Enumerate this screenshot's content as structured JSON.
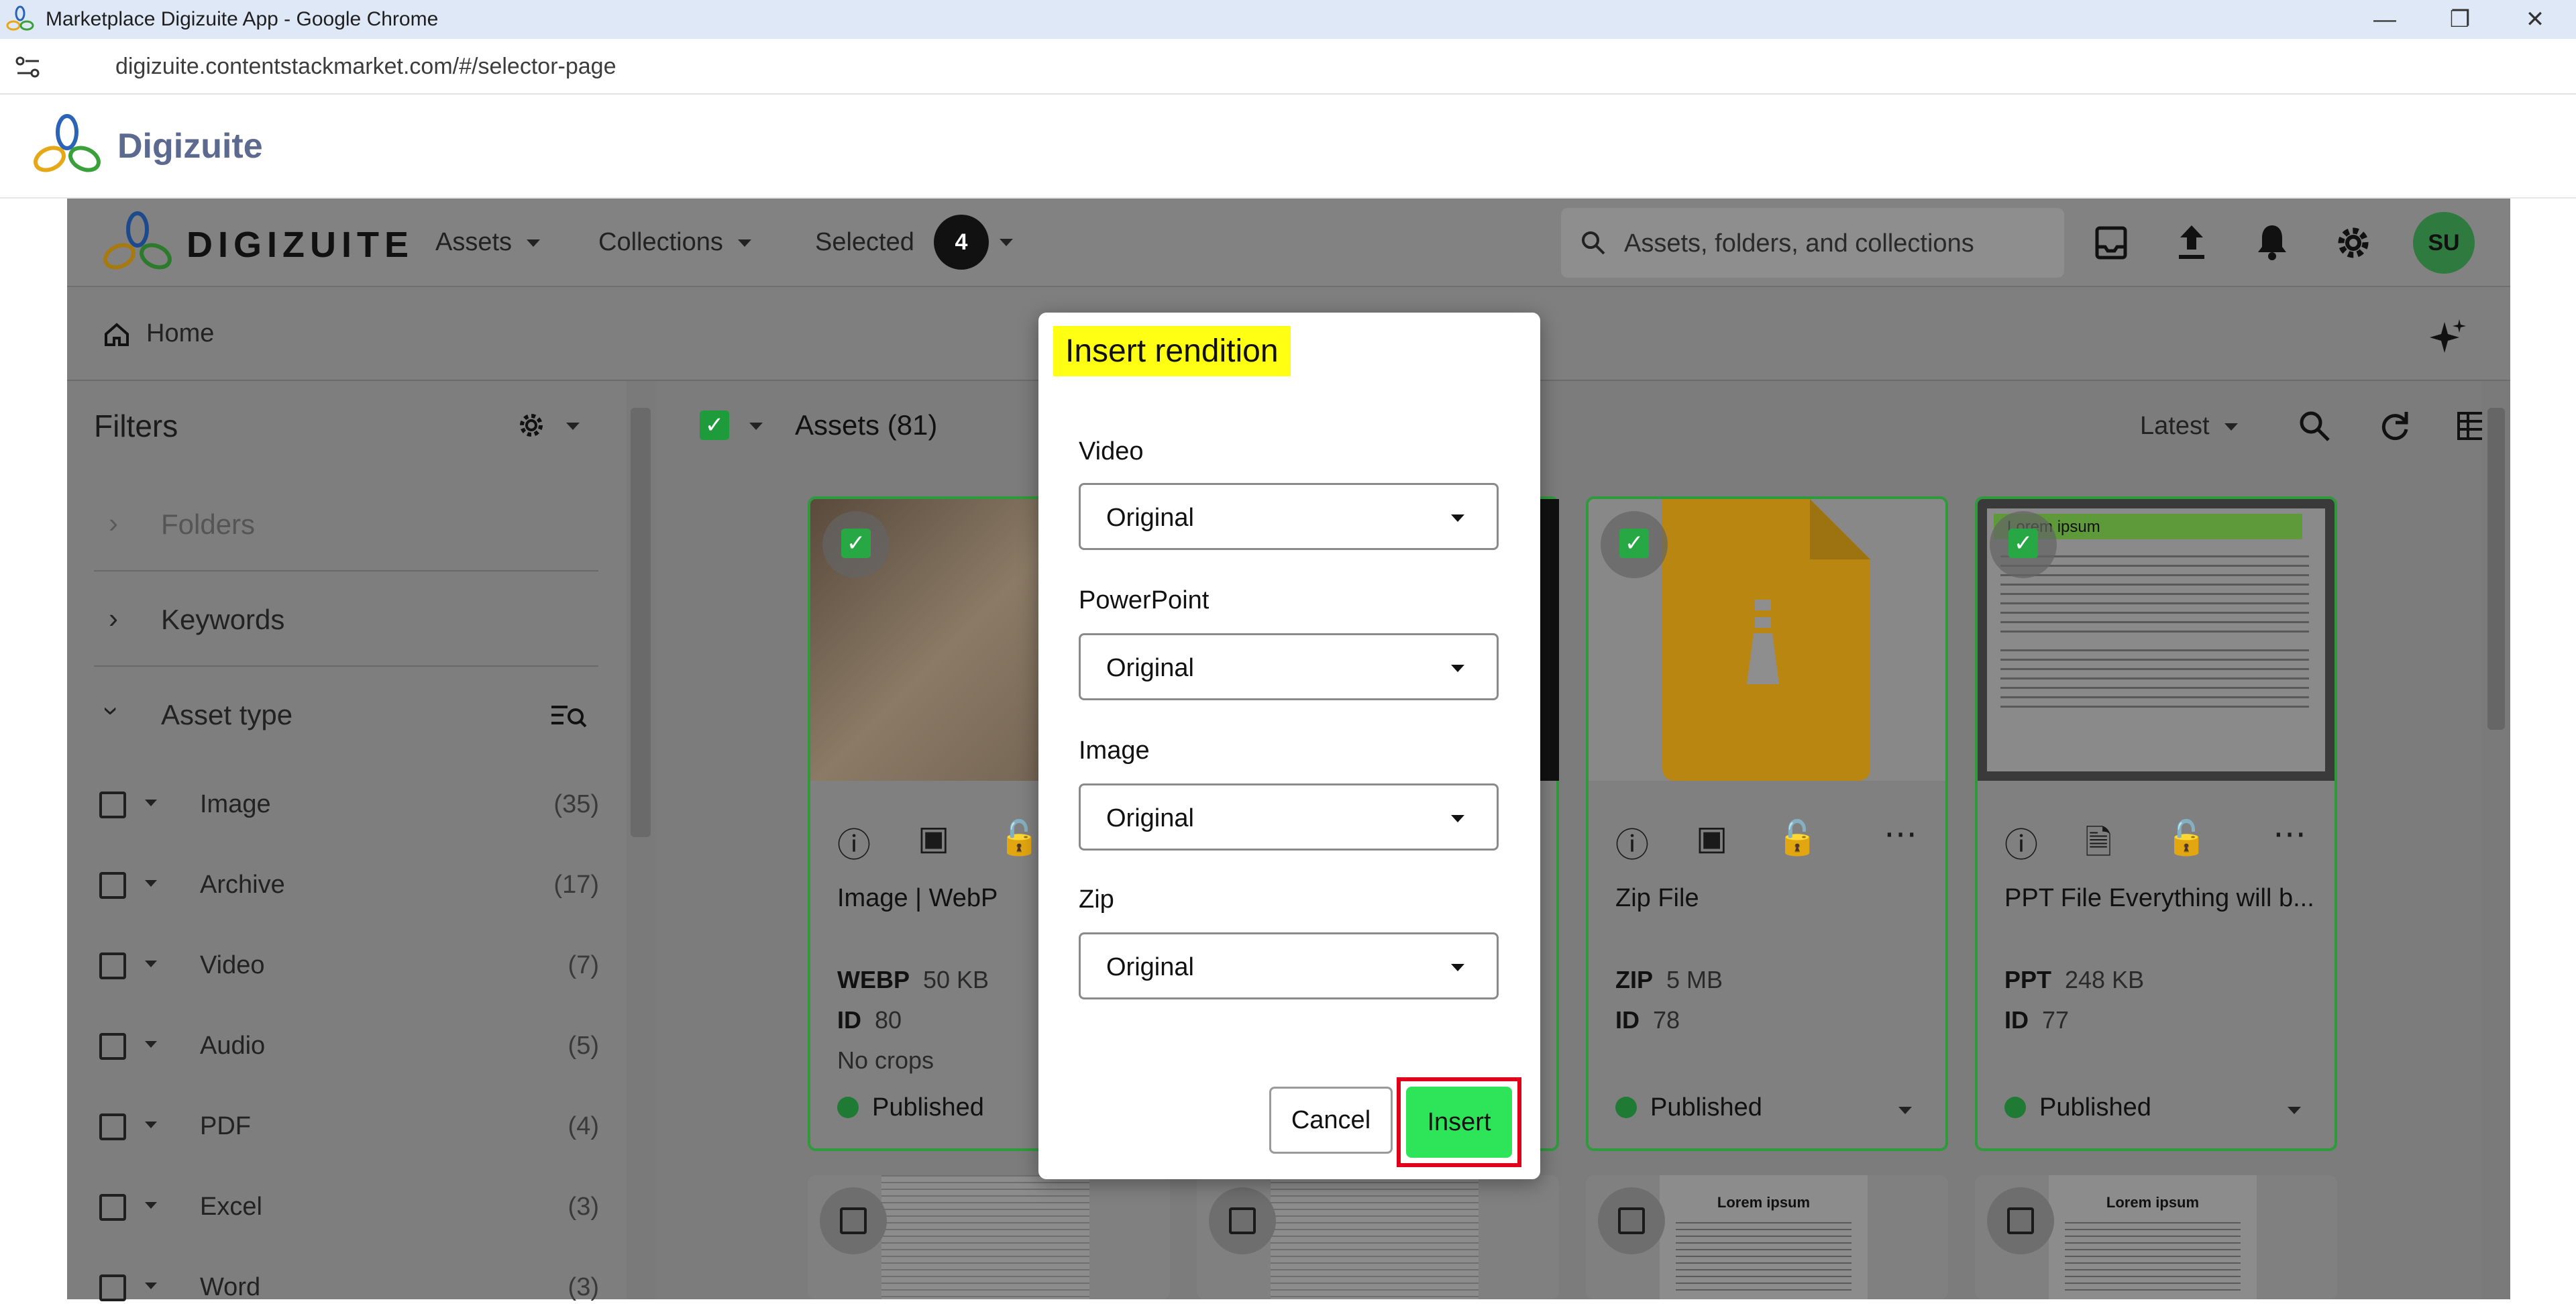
{
  "window": {
    "title": "Marketplace Digizuite App - Google Chrome",
    "url": "digizuite.contentstackmarket.com/#/selector-page"
  },
  "app_header": {
    "brand": "Digizuite"
  },
  "topnav": {
    "logo_text": "DIGIZUITE",
    "assets": "Assets",
    "collections": "Collections",
    "selected": "Selected",
    "selected_count": "4",
    "search_placeholder": "Assets, folders, and collections",
    "avatar": "SU"
  },
  "breadcrumb": {
    "home": "Home"
  },
  "filters": {
    "title": "Filters",
    "folders": "Folders",
    "keywords": "Keywords",
    "asset_type": "Asset type",
    "types": [
      {
        "name": "Image",
        "count": "(35)"
      },
      {
        "name": "Archive",
        "count": "(17)"
      },
      {
        "name": "Video",
        "count": "(7)"
      },
      {
        "name": "Audio",
        "count": "(5)"
      },
      {
        "name": "PDF",
        "count": "(4)"
      },
      {
        "name": "Excel",
        "count": "(3)"
      },
      {
        "name": "Word",
        "count": "(3)"
      }
    ]
  },
  "assets": {
    "heading": "Assets (81)",
    "sort": "Latest",
    "cards": [
      {
        "name": "Image | WebP",
        "type": "WEBP",
        "size": "50 KB",
        "id_label": "ID",
        "id": "80",
        "crops": "No crops",
        "status": "Published"
      },
      {
        "name": "Zip File",
        "type": "ZIP",
        "size": "5 MB",
        "id_label": "ID",
        "id": "78",
        "status": "Published"
      },
      {
        "name": "PPT File Everything will b...",
        "type": "PPT",
        "size": "248 KB",
        "id_label": "ID",
        "id": "77",
        "status": "Published",
        "thumb_text": "Lorem ipsum"
      }
    ],
    "row2_doc_text": "Lorem ipsum"
  },
  "modal": {
    "title": "Insert rendition",
    "fields": [
      {
        "label": "Video",
        "value": "Original"
      },
      {
        "label": "PowerPoint",
        "value": "Original"
      },
      {
        "label": "Image",
        "value": "Original"
      },
      {
        "label": "Zip",
        "value": "Original"
      }
    ],
    "cancel": "Cancel",
    "insert": "Insert"
  },
  "colors": {
    "accent_green": "#2ee55a",
    "highlight_yellow": "#ffff14",
    "highlight_red": "#e0001a",
    "card_border": "#2f9a3c"
  }
}
